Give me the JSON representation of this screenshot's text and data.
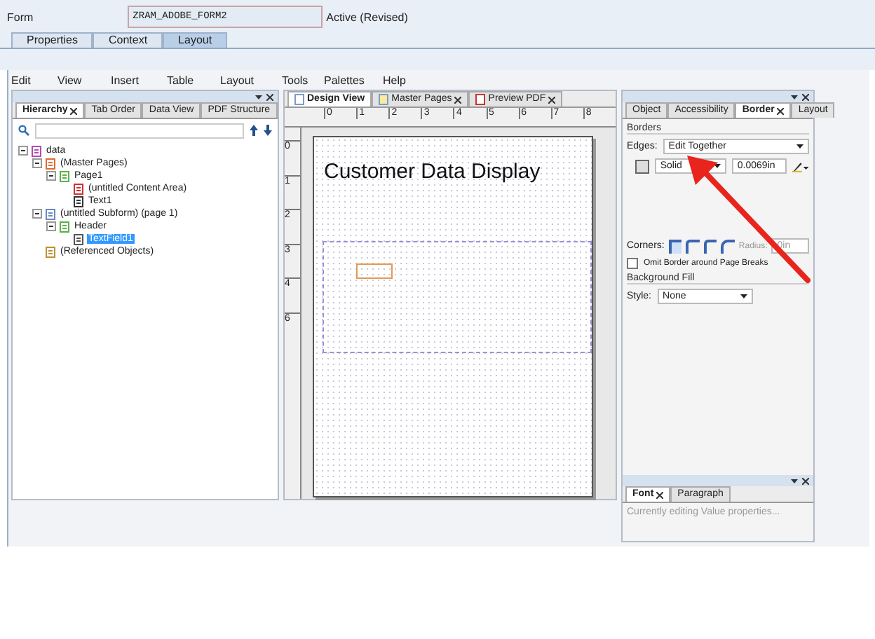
{
  "form": {
    "label": "Form",
    "value": "ZRAM_ADOBE_FORM2",
    "status": "Active (Revised)"
  },
  "tabs": [
    {
      "label": "Properties",
      "selected": false
    },
    {
      "label": "Context",
      "selected": false
    },
    {
      "label": "Layout",
      "selected": true
    }
  ],
  "menu": [
    "Edit",
    "View",
    "Insert",
    "Table",
    "Layout",
    "Tools",
    "Palettes",
    "Help"
  ],
  "hierarchy_panel": {
    "tabs": [
      {
        "label": "Hierarchy",
        "selected": true
      },
      {
        "label": "Tab Order",
        "selected": false
      },
      {
        "label": "Data View",
        "selected": false
      },
      {
        "label": "PDF Structure",
        "selected": false
      }
    ],
    "tree": [
      {
        "label": "data",
        "kind": "data",
        "expanded": true,
        "selected": false,
        "children": [
          {
            "label": "(Master Pages)",
            "kind": "master",
            "expanded": true,
            "selected": false,
            "children": [
              {
                "label": "Page1",
                "kind": "page",
                "expanded": true,
                "selected": false,
                "children": [
                  {
                    "label": "(untitled Content Area)",
                    "kind": "content-area",
                    "selected": false
                  },
                  {
                    "label": "Text1",
                    "kind": "text",
                    "selected": false
                  }
                ]
              }
            ]
          },
          {
            "label": "(untitled Subform) (page 1)",
            "kind": "subform",
            "expanded": true,
            "selected": false,
            "children": [
              {
                "label": "Header",
                "kind": "page",
                "expanded": true,
                "selected": false,
                "children": [
                  {
                    "label": "TextField1",
                    "kind": "field",
                    "selected": true
                  }
                ]
              }
            ]
          },
          {
            "label": "(Referenced Objects)",
            "kind": "references",
            "selected": false
          }
        ]
      }
    ]
  },
  "design_panel": {
    "tabs": [
      {
        "label": "Design View",
        "selected": true,
        "kind": "page"
      },
      {
        "label": "Master Pages",
        "selected": false,
        "kind": "master"
      },
      {
        "label": "Preview PDF",
        "selected": false,
        "kind": "pdf"
      }
    ],
    "ruler_h": [
      "0",
      "1",
      "2",
      "3",
      "4",
      "5",
      "6",
      "7",
      "8"
    ],
    "ruler_v": [
      "0",
      "1",
      "2",
      "3",
      "4",
      "6"
    ],
    "page_title": "Customer Data Display"
  },
  "border_panel": {
    "tabs": [
      {
        "label": "Object",
        "selected": false
      },
      {
        "label": "Accessibility",
        "selected": false
      },
      {
        "label": "Border",
        "selected": true
      },
      {
        "label": "Layout",
        "selected": false
      }
    ],
    "borders_heading": "Borders",
    "edges_label": "Edges:",
    "edges_value": "Edit Together",
    "style_value": "Solid",
    "width_value": "0.0069in",
    "corners_label": "Corners:",
    "radius_label": "Radius:",
    "radius_value": "0in",
    "omit_label": "Omit Border around Page Breaks",
    "omit_checked": false,
    "fill_heading": "Background Fill",
    "fill_style_label": "Style:",
    "fill_style_value": "None"
  },
  "font_panel": {
    "tabs": [
      {
        "label": "Font",
        "selected": true
      },
      {
        "label": "Paragraph",
        "selected": false
      }
    ],
    "status": "Currently editing Value properties..."
  }
}
